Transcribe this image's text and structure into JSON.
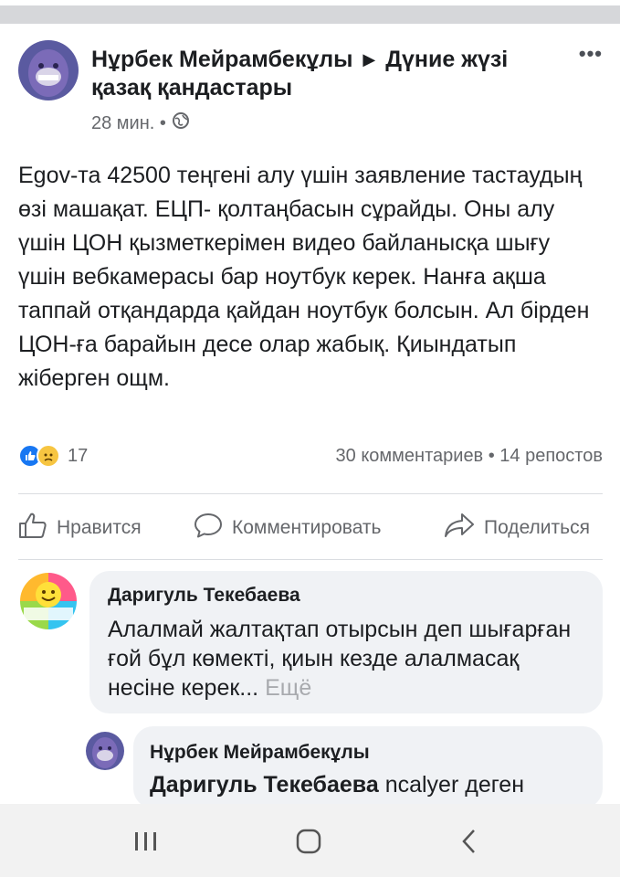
{
  "post": {
    "author": "Нұрбек Мейрамбекұлы",
    "arrow": "▶",
    "group": "Дүние жүзі қазақ қандастары",
    "time": "28 мин. •",
    "text": "Egov-та 42500 теңгені алу үшін заявление тастаудың өзі машақат. ЕЦП- қолтаңбасын сұрайды. Оны алу үшін ЦОН қызметкерімен видео байланысқа шығу үшін вебкамерасы бар ноутбук керек. Нанға ақша таппай отқандарда қайдан ноутбук болсын. Ал бірден ЦОН-ға барайын десе олар жабық. Қиындатып жіберген ощм.",
    "more_icon": "more-dots-icon"
  },
  "stats": {
    "reaction_count": "17",
    "comments_reposts": "30 комментариев • 14 репостов"
  },
  "actions": {
    "like": "Нравится",
    "comment": "Комментировать",
    "share": "Поделиться"
  },
  "comments": [
    {
      "author": "Даригуль Текебаева",
      "text": "Алалмай жалтақтап отырсын деп шығарған ғой бұл көмекті,  қиын кезде алалмасақ несіне керек...",
      "see_more": "Ещё",
      "avatar_text": "Здоровья... Счастья..."
    },
    {
      "author": "Нұрбек Мейрамбекұлы",
      "mention": "Даригуль Текебаева",
      "text": " ncalyer деген"
    }
  ],
  "colors": {
    "accent": "#1877f2",
    "secondary_text": "#65676b",
    "bubble_bg": "#f0f2f5"
  }
}
